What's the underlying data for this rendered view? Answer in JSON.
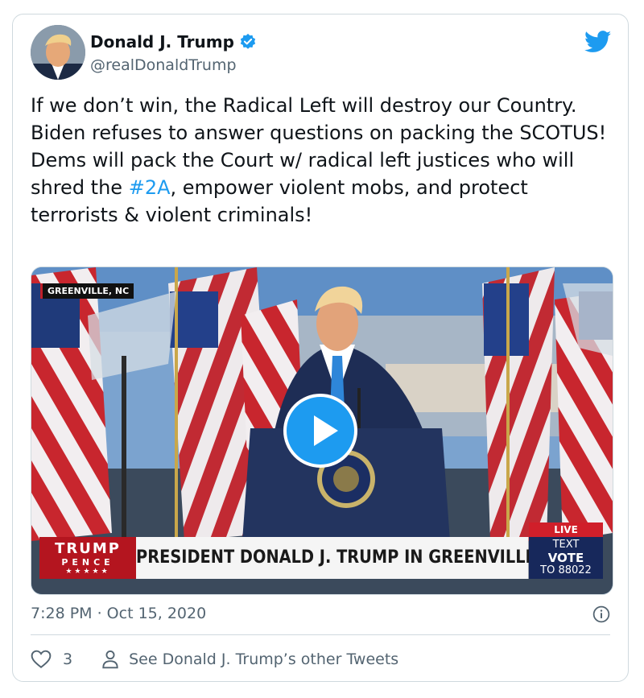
{
  "author": {
    "name": "Donald J. Trump",
    "handle": "@realDonaldTrump"
  },
  "tweet": {
    "text_before": "If we don’t win, the Radical Left will destroy our Country. Biden refuses to answer questions on packing the SCOTUS! Dems will pack the Court w/ radical left justices who will shred the ",
    "hashtag": "#2A",
    "text_after": ", empower violent mobs, and protect terrorists & violent criminals!",
    "timestamp": "7:28 PM · Oct 15, 2020"
  },
  "media": {
    "location_tag": "GREENVILLE, NC",
    "brand_line1": "TRUMP",
    "brand_line2": "PENCE",
    "brand_stars": "★★★★★",
    "headline": "PRESIDENT DONALD J. TRUMP IN GREENVILLE, NC",
    "live_label": "LIVE",
    "text_line1": "TEXT",
    "text_line2": "VOTE",
    "text_line3": "TO 88022"
  },
  "footer": {
    "like_count": "3",
    "see_other": "See Donald J. Trump’s other Tweets"
  },
  "colors": {
    "accent": "#1d9bf0",
    "text": "#0f1419",
    "muted": "#536471",
    "border": "#cfd9de"
  },
  "icons": [
    "verified-badge-icon",
    "twitter-bird-icon",
    "play-icon",
    "info-icon",
    "heart-icon",
    "person-icon"
  ]
}
